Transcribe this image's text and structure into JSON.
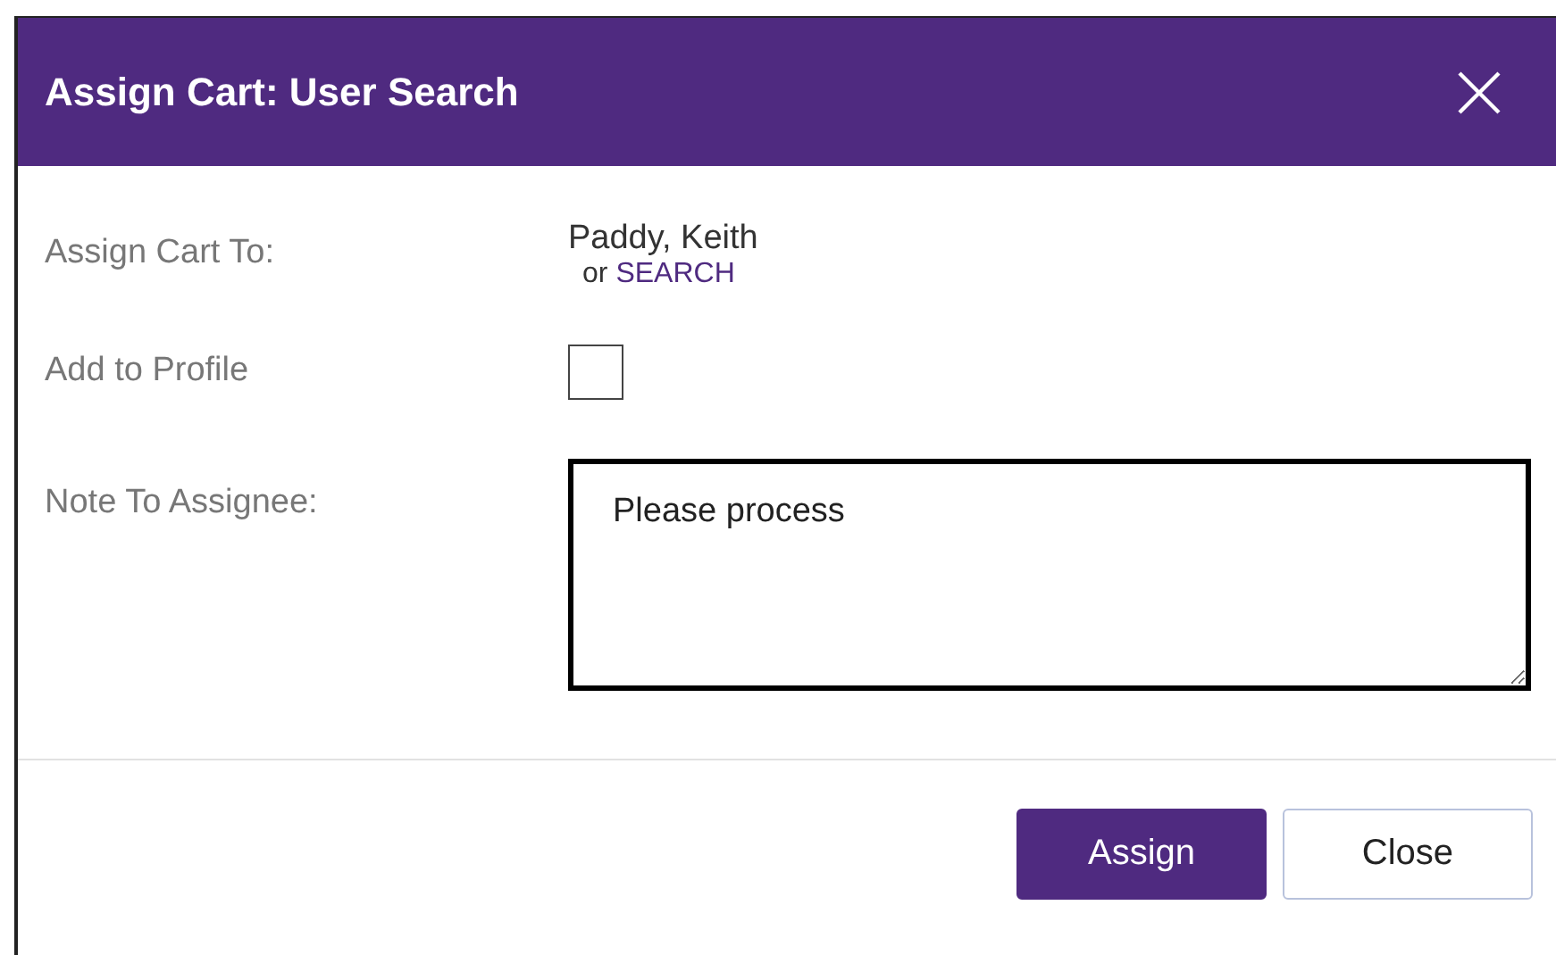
{
  "dialog": {
    "title": "Assign Cart: User Search"
  },
  "fields": [
    {
      "kind": "assignee",
      "label": "Assign Cart To:",
      "value": "Paddy, Keith",
      "connector": "or",
      "link": "SEARCH"
    },
    {
      "kind": "checkbox",
      "label": "Add to Profile",
      "checked": false
    },
    {
      "kind": "note",
      "label": "Note To Assignee:",
      "value": "Please process"
    }
  ],
  "buttons": [
    {
      "label": "Assign",
      "primary": true
    },
    {
      "label": "Close",
      "primary": false
    }
  ]
}
